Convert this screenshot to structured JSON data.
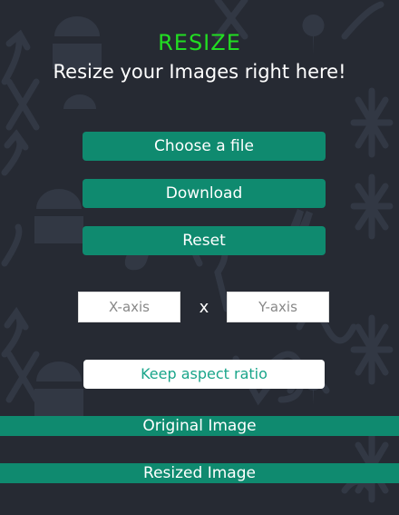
{
  "header": {
    "title": "RESIZE",
    "subtitle": "Resize your Images right here!"
  },
  "actions": {
    "choose_label": "Choose a file",
    "download_label": "Download",
    "reset_label": "Reset"
  },
  "dimensions": {
    "x_placeholder": "X-axis",
    "separator": "x",
    "y_placeholder": "Y-axis"
  },
  "aspect": {
    "label": "Keep aspect ratio"
  },
  "sections": {
    "original_label": "Original Image",
    "resized_label": "Resized Image"
  },
  "colors": {
    "background": "#262a33",
    "accent": "#0f8a6f",
    "title": "#22dd22",
    "pattern": "#323844"
  }
}
